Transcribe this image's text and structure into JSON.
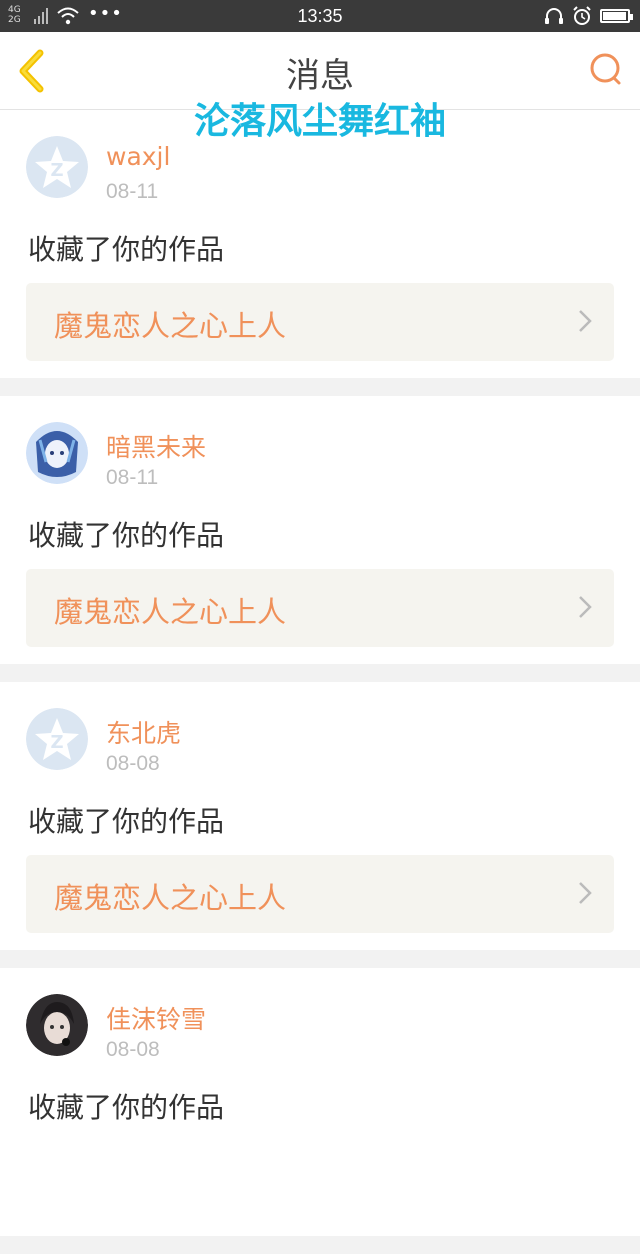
{
  "status_bar": {
    "net_top": "4G",
    "net_bottom": "2G",
    "dots": "•••",
    "time": "13:35",
    "battery_level": 0.95
  },
  "header": {
    "title": "消息",
    "watermark": "沦落风尘舞红袖",
    "accent_color": "#f0915a"
  },
  "messages": [
    {
      "username": "waxjl",
      "date": "08-11",
      "action": "收藏了你的作品",
      "work": "魔鬼恋人之心上人",
      "avatar": "default-avatar"
    },
    {
      "username": "暗黑未来",
      "date": "08-11",
      "action": "收藏了你的作品",
      "work": "魔鬼恋人之心上人",
      "avatar": "anime-avatar-blue"
    },
    {
      "username": "东北虎",
      "date": "08-08",
      "action": "收藏了你的作品",
      "work": "魔鬼恋人之心上人",
      "avatar": "default-avatar"
    },
    {
      "username": "佳沫铃雪",
      "date": "08-08",
      "action": "收藏了你的作品",
      "work": "",
      "avatar": "anime-avatar-dark"
    }
  ]
}
